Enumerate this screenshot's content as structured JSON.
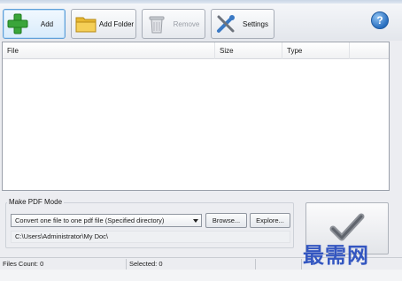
{
  "toolbar": {
    "add_label": "Add",
    "add_folder_label": "Add Folder",
    "remove_label": "Remove",
    "settings_label": "Settings",
    "help_label": "?"
  },
  "file_list": {
    "columns": [
      "File",
      "Size",
      "Type"
    ],
    "rows": []
  },
  "mode": {
    "group_title": "Make PDF Mode",
    "selected": "Convert one file to one pdf file (Specified directory)",
    "browse_label": "Browse...",
    "explore_label": "Explore...",
    "output_path": "C:\\Users\\Administrator\\My Doc\\"
  },
  "status": {
    "files_count": "Files Count: 0",
    "selected": "Selected: 0"
  },
  "watermark": "最需网",
  "colors": {
    "accent_blue": "#2a6fbf",
    "add_green": "#3aa53a",
    "folder_yellow": "#e8b832",
    "watermark_blue": "#2b4fbf"
  },
  "icons": {
    "add": "green-plus-icon",
    "add_folder": "folder-icon",
    "remove": "trash-bin-icon",
    "settings": "tools-icon",
    "help": "help-icon",
    "convert": "checkmark-icon"
  }
}
